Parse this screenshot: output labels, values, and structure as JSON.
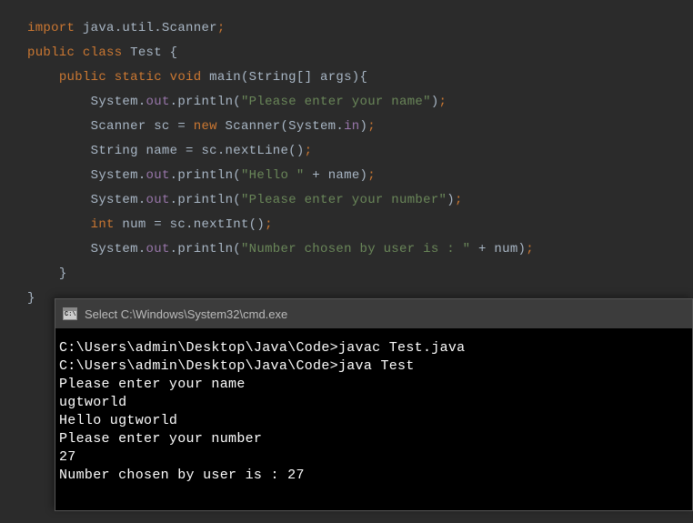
{
  "code": {
    "import_kw": "import",
    "import_pkg": " java.util.Scanner",
    "semi": ";",
    "public_kw": "public",
    "class_kw": "class",
    "class_name": " Test ",
    "brace_open": "{",
    "brace_close": "}",
    "static_kw": "static",
    "void_kw": "void",
    "main_sig": " main(String[] args){",
    "sysout": "System",
    "dot": ".",
    "out_field": "out",
    "println": "println",
    "str_enter_name": "\"Please enter your name\"",
    "scanner_decl": "Scanner sc ",
    "equals": "= ",
    "new_kw": "new",
    "scanner_ctor": " Scanner(System",
    "in_field": "in",
    "paren_close": ")",
    "string_decl": "String name ",
    "nextline_call": "sc.nextLine()",
    "str_hello": "\"Hello \"",
    "plus_name": " + name",
    "str_enter_number": "\"Please enter your number\"",
    "int_kw": "int",
    "num_decl": " num ",
    "nextint_call": "sc.nextInt()",
    "str_number_chosen": "\"Number chosen by user is : \"",
    "plus_num": " + num"
  },
  "terminal": {
    "title": "Select C:\\Windows\\System32\\cmd.exe",
    "lines": [
      "C:\\Users\\admin\\Desktop\\Java\\Code>javac Test.java",
      "",
      "C:\\Users\\admin\\Desktop\\Java\\Code>java Test",
      "Please enter your name",
      "ugtworld",
      "Hello ugtworld",
      "Please enter your number",
      "27",
      "Number chosen by user is : 27"
    ]
  }
}
